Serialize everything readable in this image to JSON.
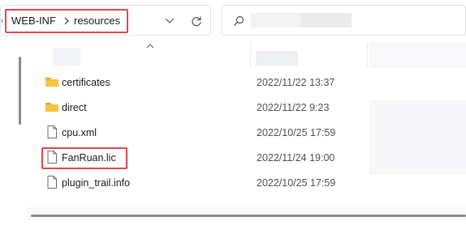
{
  "address_bar": {
    "crumbs": [
      {
        "label": "WEB-INF"
      },
      {
        "label": "resources"
      }
    ]
  },
  "search": {
    "placeholder": ""
  },
  "files": [
    {
      "name": "certificates",
      "date": "2022/11/22 13:37",
      "icon": "folder-icon"
    },
    {
      "name": "direct",
      "date": "2022/11/22 9:23",
      "icon": "folder-icon"
    },
    {
      "name": "cpu.xml",
      "date": "2022/10/25 17:59",
      "icon": "document-icon"
    },
    {
      "name": "FanRuan.lic",
      "date": "2022/11/24 19:00",
      "icon": "document-icon",
      "highlighted": true
    },
    {
      "name": "plugin_trail.info",
      "date": "2022/10/25 17:59",
      "icon": "document-icon"
    }
  ],
  "colors": {
    "highlight_border": "#e0464c",
    "folder_yellow": "#f5c542",
    "folder_dark": "#e0a520"
  }
}
